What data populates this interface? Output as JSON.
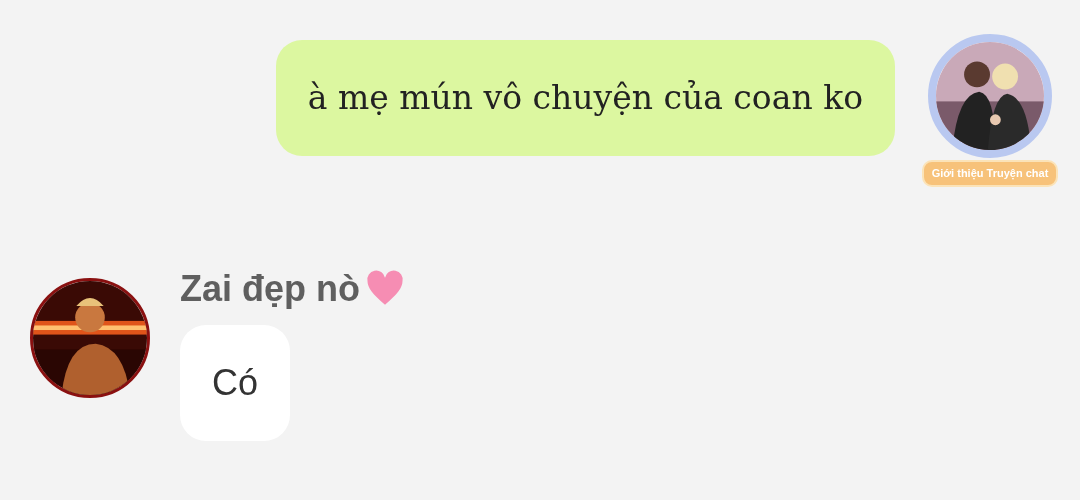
{
  "messages": [
    {
      "kind": "outgoing",
      "text": "à mẹ mún vô chuyện của coan ko",
      "badge": "Giới thiệu Truyện chat"
    },
    {
      "kind": "incoming",
      "sender": "Zai đẹp nò",
      "text": "Có"
    }
  ]
}
